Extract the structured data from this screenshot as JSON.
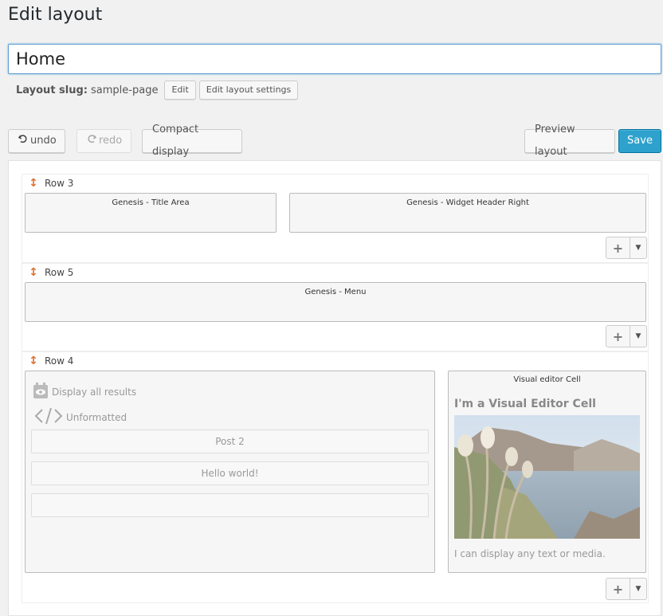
{
  "header": {
    "title": "Edit layout",
    "layout_name": "Home",
    "slug_label": "Layout slug:",
    "slug_value": "sample-page",
    "edit_label": "Edit",
    "settings_label": "Edit layout settings"
  },
  "toolbar": {
    "undo_label": "undo",
    "redo_label": "redo",
    "compact_label": "Compact display",
    "preview_label": "Preview layout",
    "save_label": "Save"
  },
  "rows": [
    {
      "label": "Row 3",
      "cells": [
        "Genesis - Title Area",
        "Genesis - Widget Header Right"
      ]
    },
    {
      "label": "Row 5",
      "cells": [
        "Genesis - Menu"
      ]
    },
    {
      "label": "Row 4",
      "view_cell": {
        "display_label": "Display all results",
        "format_label": "Unformatted",
        "results": [
          "Post 2",
          "Hello world!",
          ""
        ]
      },
      "visual_cell": {
        "title": "Visual editor Cell",
        "heading": "I'm a Visual Editor Cell",
        "caption": "I can display any text or media."
      }
    }
  ],
  "colors": {
    "accent": "#2ea2cc",
    "handle": "#e0702b",
    "background": "#f1f1f1"
  },
  "icons": {
    "undo": "undo-icon",
    "redo": "redo-icon",
    "drag": "drag-handle-icon",
    "add": "plus-icon",
    "menu": "caret-down-icon",
    "view": "view-icon",
    "code": "code-icon"
  }
}
